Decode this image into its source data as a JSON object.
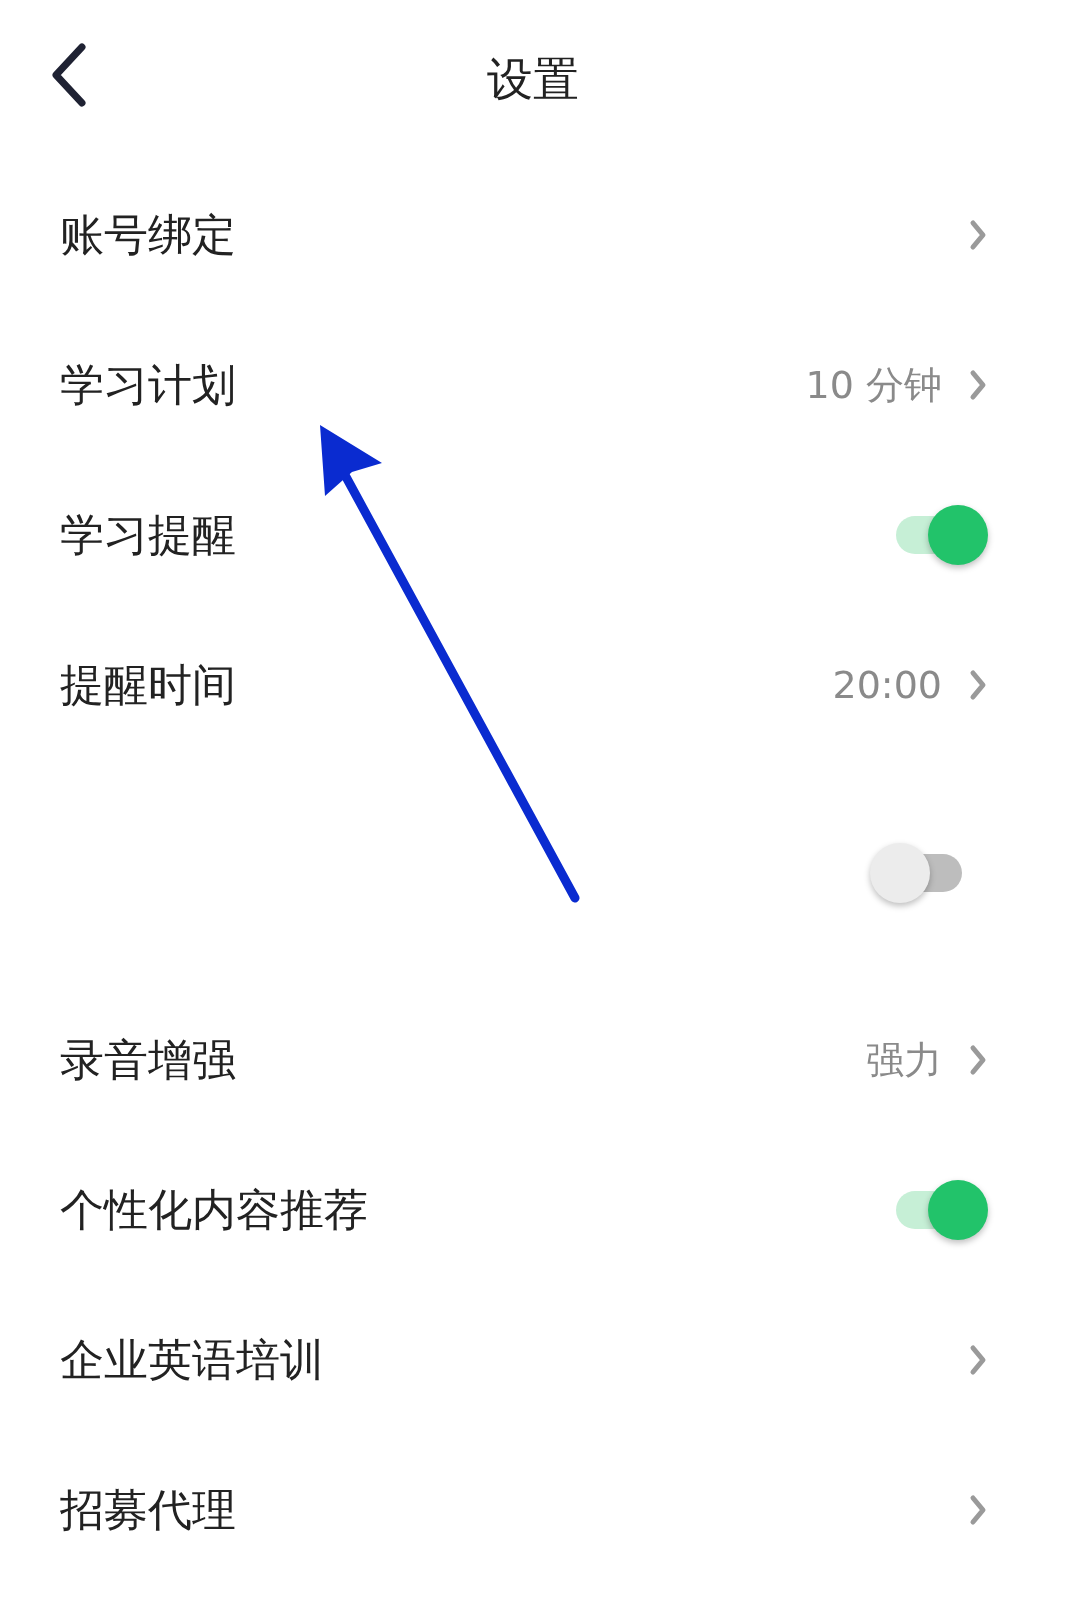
{
  "header": {
    "title": "设置"
  },
  "rows": [
    {
      "kind": "link",
      "label": "账号绑定"
    },
    {
      "kind": "link",
      "label": "学习计划",
      "value": "10 分钟"
    },
    {
      "kind": "toggle",
      "label": "学习提醒",
      "on": true
    },
    {
      "kind": "link",
      "label": "提醒时间",
      "value": "20:00"
    },
    {
      "kind": "toggle",
      "on": false
    },
    {
      "kind": "link",
      "label": "录音增强",
      "value": "强力"
    },
    {
      "kind": "toggle",
      "label": "个性化内容推荐",
      "on": true
    },
    {
      "kind": "link",
      "label": "企业英语培训"
    },
    {
      "kind": "link",
      "label": "招募代理"
    }
  ]
}
